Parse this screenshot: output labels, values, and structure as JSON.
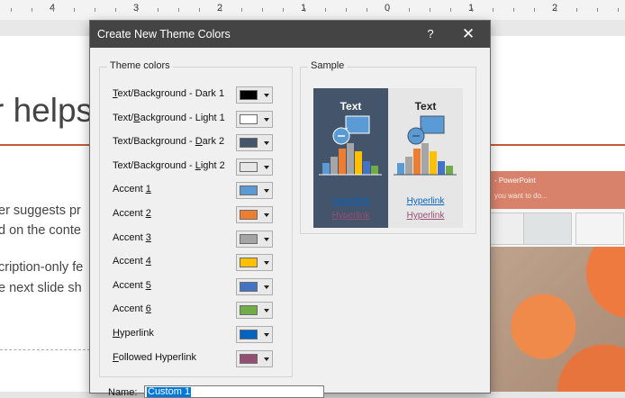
{
  "ruler": {
    "labels": [
      "4",
      "3",
      "2",
      "1",
      "0",
      "1",
      "2"
    ]
  },
  "background_slide": {
    "title": "r helps",
    "body_lines": [
      "er suggests pr",
      "d on the conte",
      "cription-only fe",
      "e next slide sh"
    ]
  },
  "background_app": {
    "title": "- PowerPoint",
    "tell_me": "you want to do..."
  },
  "dialog": {
    "title": "Create New Theme Colors",
    "help_label": "?",
    "close_label": "✕",
    "theme_colors_legend": "Theme colors",
    "rows": [
      {
        "pre": "",
        "key": "T",
        "post": "ext/Background - Dark 1",
        "color": "#000000"
      },
      {
        "pre": "Text/",
        "key": "B",
        "post": "ackground - Light 1",
        "color": "#ffffff"
      },
      {
        "pre": "Text/Background - ",
        "key": "D",
        "post": "ark 2",
        "color": "#44546a"
      },
      {
        "pre": "Text/Background - ",
        "key": "L",
        "post": "ight 2",
        "color": "#e7e6e6"
      },
      {
        "pre": "Accent ",
        "key": "1",
        "post": "",
        "color": "#5b9bd5"
      },
      {
        "pre": "Accent ",
        "key": "2",
        "post": "",
        "color": "#ed7d31"
      },
      {
        "pre": "Accent ",
        "key": "3",
        "post": "",
        "color": "#a5a5a5"
      },
      {
        "pre": "Accent ",
        "key": "4",
        "post": "",
        "color": "#ffc000"
      },
      {
        "pre": "Accent ",
        "key": "5",
        "post": "",
        "color": "#4472c4"
      },
      {
        "pre": "Accent ",
        "key": "6",
        "post": "",
        "color": "#70ad47"
      },
      {
        "pre": "",
        "key": "H",
        "post": "yperlink",
        "color": "#0563c1"
      },
      {
        "pre": "",
        "key": "F",
        "post": "ollowed Hyperlink",
        "color": "#954f72"
      }
    ],
    "sample_legend": "Sample",
    "sample": {
      "text_label": "Text",
      "hyperlink_label": "Hyperlink",
      "followed_hyperlink_label": "Hyperlink"
    },
    "name_label": "Name:",
    "name_value": "Custom 1"
  },
  "colors": {
    "titlebar": "#444444",
    "accent_line": "#c75a3a",
    "chart_bars": [
      "#5b9bd5",
      "#a5a5a5",
      "#ed7d31",
      "#a5a5a5",
      "#ffc000",
      "#4472c4",
      "#70ad47"
    ]
  }
}
